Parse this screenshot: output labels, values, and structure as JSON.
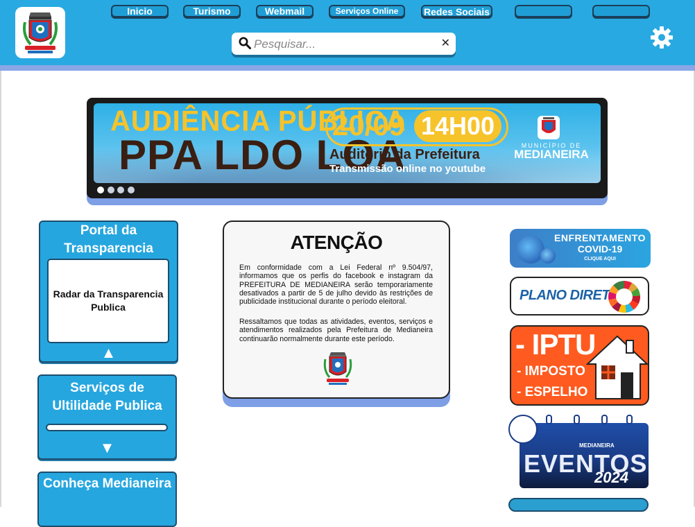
{
  "header": {
    "nav": [
      {
        "label": "Inicio"
      },
      {
        "label": "Turismo"
      },
      {
        "label": "Webmail"
      },
      {
        "label": "Serviços Online"
      },
      {
        "label": "Redes Sociais"
      },
      {
        "label": ""
      },
      {
        "label": ""
      }
    ],
    "search": {
      "placeholder": "Pesquisar...",
      "value": ""
    },
    "clear_symbol": "✕"
  },
  "banner": {
    "line1": "AUDIÊNCIA PÚBLICA",
    "line2": "PPA LDO LOA",
    "date": "20/09",
    "time": "14H00",
    "place": "Auditório da Prefeitura",
    "stream": "Transmissão online no youtube",
    "municipio": "MUNICÍPIO DE",
    "city": "MEDIANEIRA",
    "slides": 4,
    "active_slide": 1
  },
  "left_panels": [
    {
      "title": "Portal da Transparencia",
      "item": "Radar da Transparencia Publica",
      "toggle": "▲"
    },
    {
      "title": "Serviços de Ultilidade Publica",
      "toggle": "▼"
    },
    {
      "title": "Conheça Medianeira"
    }
  ],
  "notice": {
    "title": "ATENÇÃO",
    "paragraph1": "Em conformidade com a Lei Federal nº 9.504/97, informamos que os perfis do facebook e instagram da PREFEITURA DE MEDIANEIRA serão temporariamente desativados a partir de 5 de julho devido às restrições de publicidade institucional durante o período eleitoral.",
    "paragraph2": "Ressaltamos que todas as atividades, eventos, serviços e atendimentos realizados pela Prefeitura de Medianeira continuarão normalmente durante este período."
  },
  "right_banners": {
    "covid": {
      "line1": "ENFRENTAMENTO",
      "line2": "COVID-19",
      "cta": "CLIQUE AQUI"
    },
    "plano": {
      "label": "PLANO DIRETOR"
    },
    "iptu": {
      "line1": "- IPTU",
      "line2": "- IMPOSTO",
      "line3": "- ESPELHO"
    },
    "eventos": {
      "city": "MEDIANEIRA",
      "title": "EVENTOS",
      "year": "2024"
    }
  },
  "colors": {
    "header": "#29a9e1",
    "accent": "#1b4d6e",
    "banner_yellow": "#f6c32b",
    "iptu_orange": "#ff5a1f"
  },
  "icons": {
    "search": "search-icon",
    "settings": "gear-icon",
    "clear": "close-icon",
    "logo": "coat-of-arms-icon"
  }
}
